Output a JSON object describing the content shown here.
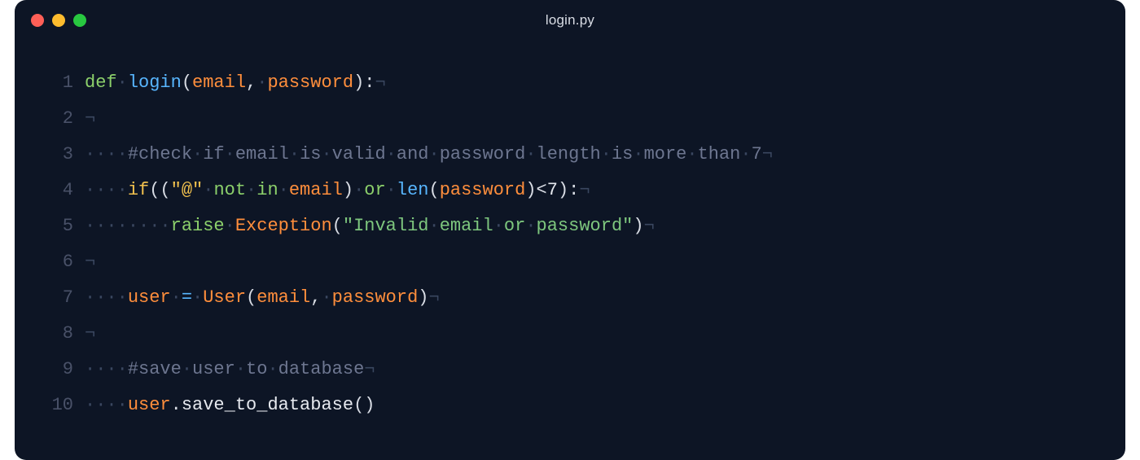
{
  "title": "login.py",
  "whitespace": {
    "dot": "·",
    "nl": "¬"
  },
  "lines": [
    {
      "num": "1"
    },
    {
      "num": "2"
    },
    {
      "num": "3"
    },
    {
      "num": "4"
    },
    {
      "num": "5"
    },
    {
      "num": "6"
    },
    {
      "num": "7"
    },
    {
      "num": "8"
    },
    {
      "num": "9"
    },
    {
      "num": "10"
    }
  ],
  "tokens": {
    "def": "def",
    "login": "login",
    "email": "email",
    "password": "password",
    "comma": ",",
    "colon": ":",
    "lparen": "(",
    "rparen": ")",
    "comment1": "#check",
    "c_if": "if",
    "c_email": "email",
    "c_is": "is",
    "c_valid": "valid",
    "c_and": "and",
    "c_password": "password",
    "c_length": "length",
    "c_more": "more",
    "c_than": "than",
    "c_7": "7",
    "if": "if",
    "at": "\"@\"",
    "not": "not",
    "in": "in",
    "or": "or",
    "len": "len",
    "lt": "<",
    "seven": "7",
    "raise": "raise",
    "exception": "Exception",
    "errmsg_q1": "\"Invalid",
    "errmsg_email": "email",
    "errmsg_or": "or",
    "errmsg_pw": "password\"",
    "user": "user",
    "eq": "=",
    "User": "User",
    "comment2": "#save",
    "c2_user": "user",
    "c2_to": "to",
    "c2_db": "database",
    "dot": ".",
    "save_method": "save_to_database"
  }
}
